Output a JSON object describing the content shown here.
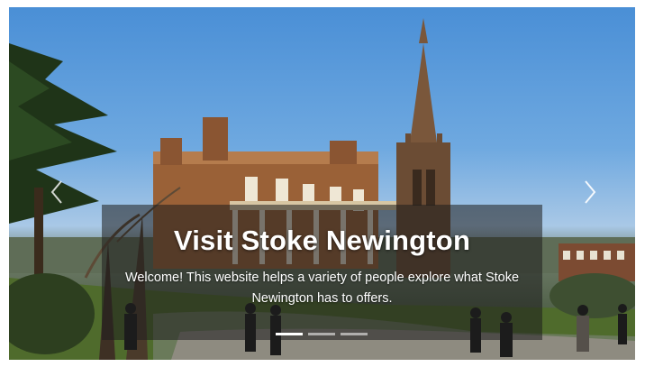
{
  "hero": {
    "title": "Visit Stoke Newington",
    "description": "Welcome! This website helps a variety of people explore what Stoke Newington has to offers."
  },
  "carousel": {
    "slide_count": 3,
    "active_index": 0,
    "prev_icon": "chevron-left-icon",
    "next_icon": "chevron-right-icon"
  }
}
